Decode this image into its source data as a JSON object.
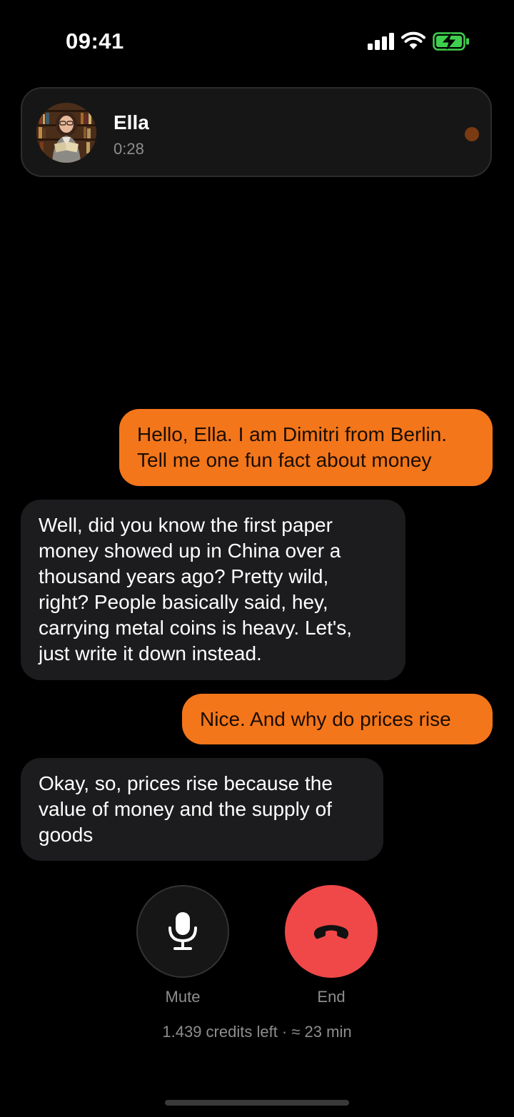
{
  "status_bar": {
    "time": "09:41",
    "icons": [
      "signal-icon",
      "wifi-icon",
      "battery-charging-icon"
    ]
  },
  "header": {
    "name": "Ella",
    "duration": "0:28",
    "avatar": "avatar-photo",
    "indicator": "recording-dot",
    "indicator_color": "#7a3a12"
  },
  "messages": [
    {
      "role": "user",
      "text": "Hello, Ella. I am Dimitri from Berlin.\nTell me one fun fact about money"
    },
    {
      "role": "assistant",
      "text": "Well, did you know the first paper\nmoney showed up in China over a\nthousand years ago? Pretty wild,\nright? People basically said, hey,\ncarrying metal coins is heavy. Let's,\njust write it down instead."
    },
    {
      "role": "user",
      "text": "Nice. And why do prices rise"
    },
    {
      "role": "assistant",
      "text": "Okay, so, prices rise because the\nvalue of money and the supply of\ngoods"
    }
  ],
  "controls": {
    "mute_label": "Mute",
    "mute_icon": "microphone-icon",
    "end_label": "End",
    "end_icon": "hang-up-phone-icon"
  },
  "credits": "1.439 credits left · ≈ 23 min",
  "colors": {
    "background": "#000000",
    "user_bubble": "#f4761b",
    "assistant_bubble": "#1c1c1e",
    "end_button": "#f04848",
    "battery": "#3fcf4f"
  }
}
